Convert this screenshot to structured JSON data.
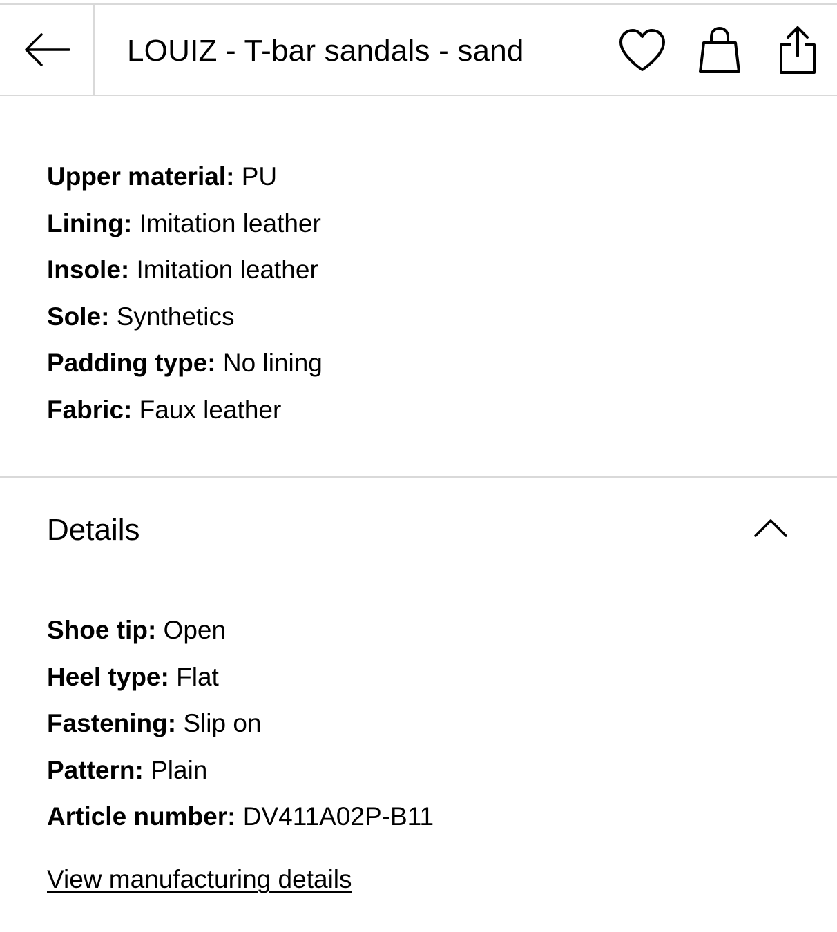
{
  "header": {
    "title": "LOUIZ - T-bar sandals - sand",
    "back_icon": "arrow-left-icon",
    "actions": [
      {
        "name": "wishlist",
        "icon": "heart-icon"
      },
      {
        "name": "bag",
        "icon": "shopping-bag-icon"
      },
      {
        "name": "share",
        "icon": "share-icon"
      }
    ]
  },
  "material": {
    "items": [
      {
        "label": "Upper material:",
        "value": "PU"
      },
      {
        "label": "Lining:",
        "value": "Imitation leather"
      },
      {
        "label": "Insole:",
        "value": "Imitation leather"
      },
      {
        "label": "Sole:",
        "value": "Synthetics"
      },
      {
        "label": "Padding type:",
        "value": "No lining"
      },
      {
        "label": "Fabric:",
        "value": "Faux leather"
      }
    ]
  },
  "details": {
    "title": "Details",
    "expanded": true,
    "toggle_icon": "chevron-up-icon",
    "items": [
      {
        "label": "Shoe tip:",
        "value": "Open"
      },
      {
        "label": "Heel type:",
        "value": "Flat"
      },
      {
        "label": "Fastening:",
        "value": "Slip on"
      },
      {
        "label": "Pattern:",
        "value": "Plain"
      },
      {
        "label": "Article number:",
        "value": "DV411A02P-B11"
      }
    ],
    "manufacturing_link": "View manufacturing details"
  },
  "colors": {
    "text": "#000000",
    "divider": "#d9d9d9",
    "background": "#ffffff"
  }
}
